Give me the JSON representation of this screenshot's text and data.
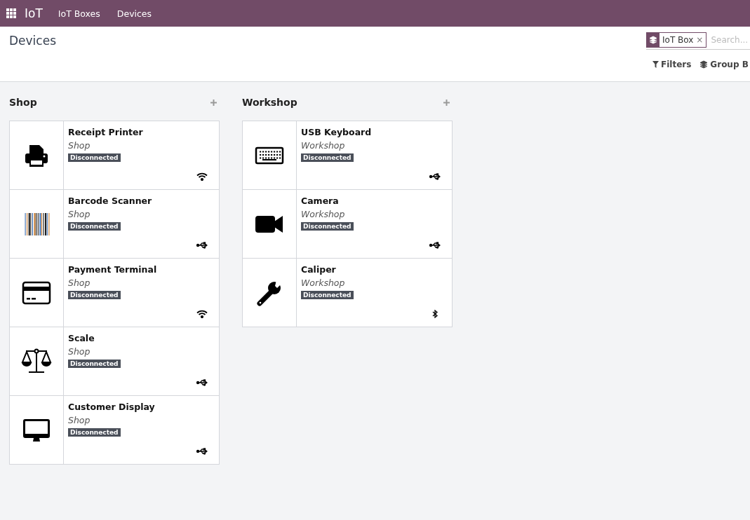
{
  "navbar": {
    "app_name": "IoT",
    "menu": [
      {
        "label": "IoT Boxes"
      },
      {
        "label": "Devices"
      }
    ]
  },
  "breadcrumb": "Devices",
  "search": {
    "facet": "IoT Box",
    "facet_remove": "×",
    "placeholder": "Search...",
    "filters": "Filters",
    "group_by": "Group B"
  },
  "columns": [
    {
      "title": "Shop",
      "cards": [
        {
          "name": "Receipt Printer",
          "location": "Shop",
          "status": "Disconnected",
          "kind": "printer",
          "connection": {
            "kind": "wifi"
          }
        },
        {
          "name": "Barcode Scanner",
          "location": "Shop",
          "status": "Disconnected",
          "kind": "barcode",
          "connection": {
            "kind": "usb"
          }
        },
        {
          "name": "Payment Terminal",
          "location": "Shop",
          "status": "Disconnected",
          "kind": "card",
          "connection": {
            "kind": "wifi"
          }
        },
        {
          "name": "Scale",
          "location": "Shop",
          "status": "Disconnected",
          "kind": "scale",
          "connection": {
            "kind": "usb"
          }
        },
        {
          "name": "Customer Display",
          "location": "Shop",
          "status": "Disconnected",
          "kind": "monitor",
          "connection": {
            "kind": "usb"
          }
        }
      ]
    },
    {
      "title": "Workshop",
      "cards": [
        {
          "name": "USB Keyboard",
          "location": "Workshop",
          "status": "Disconnected",
          "kind": "keyboard",
          "connection": {
            "kind": "usb"
          }
        },
        {
          "name": "Camera",
          "location": "Workshop",
          "status": "Disconnected",
          "kind": "camera",
          "connection": {
            "kind": "usb"
          }
        },
        {
          "name": "Caliper",
          "location": "Workshop",
          "status": "Disconnected",
          "kind": "wrench",
          "connection": {
            "kind": "bluetooth"
          }
        }
      ]
    }
  ]
}
